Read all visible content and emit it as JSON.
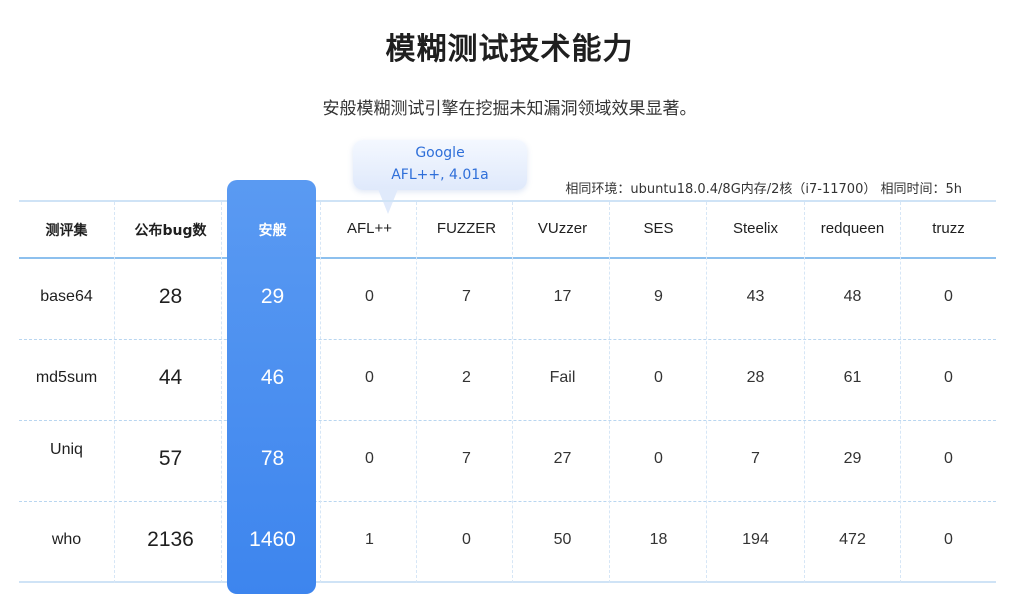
{
  "title": "模糊测试技术能力",
  "subtitle": "安般模糊测试引擎在挖掘未知漏洞领域效果显著。",
  "bubble": {
    "line1": "Google",
    "line2": "AFL++, 4.01a"
  },
  "environment_note": "相同环境：ubuntu18.0.4/8G内存/2核（i7-11700） 相同时间：5h",
  "colors": {
    "highlight": "#4a8ff0",
    "header_rule": "#8dc0ee",
    "bubble_text": "#2f6fd9"
  },
  "table": {
    "headers": [
      "测评集",
      "公布bug数",
      "安般",
      "AFL++",
      "FUZZER",
      "VUzzer",
      "SES",
      "Steelix",
      "redqueen",
      "truzz"
    ],
    "rows": [
      [
        "base64",
        "28",
        "29",
        "0",
        "7",
        "17",
        "9",
        "43",
        "48",
        "0"
      ],
      [
        "md5sum",
        "44",
        "46",
        "0",
        "2",
        "Fail",
        "0",
        "28",
        "61",
        "0"
      ],
      [
        "Uniq",
        "57",
        "78",
        "0",
        "7",
        "27",
        "0",
        "7",
        "29",
        "0"
      ],
      [
        "who",
        "2136",
        "1460",
        "1",
        "0",
        "50",
        "18",
        "194",
        "472",
        "0"
      ]
    ]
  }
}
